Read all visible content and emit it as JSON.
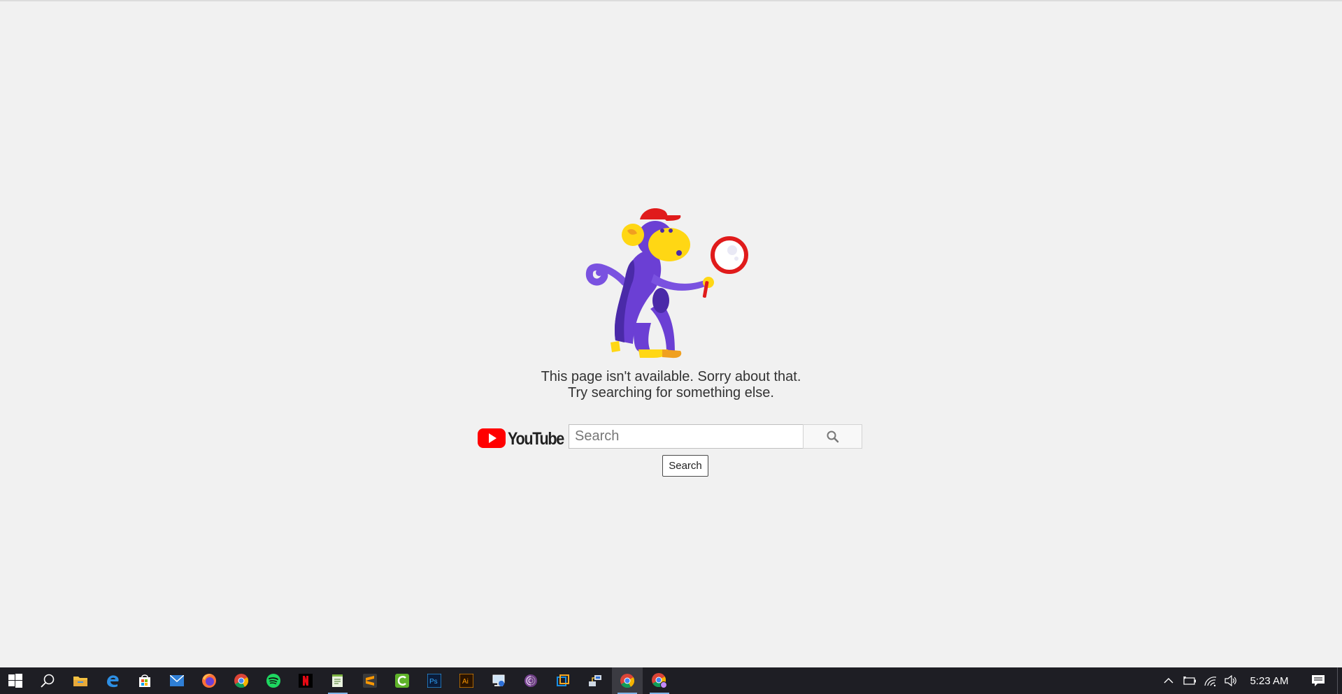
{
  "page": {
    "error_line1": "This page isn't available. Sorry about that.",
    "error_line2": "Try searching for something else."
  },
  "search": {
    "placeholder": "Search",
    "submit_label": "Search"
  },
  "logo": {
    "wordmark": "YouTube"
  },
  "taskbar": {
    "pinned_apps": [
      {
        "name": "start",
        "icon": "windows-icon"
      },
      {
        "name": "search",
        "icon": "search-icon"
      },
      {
        "name": "file-explorer",
        "icon": "folder-icon"
      },
      {
        "name": "edge",
        "icon": "edge-icon"
      },
      {
        "name": "store",
        "icon": "store-icon"
      },
      {
        "name": "mail",
        "icon": "mail-icon"
      },
      {
        "name": "firefox",
        "icon": "firefox-icon"
      },
      {
        "name": "chrome",
        "icon": "chrome-icon"
      },
      {
        "name": "spotify",
        "icon": "spotify-icon"
      },
      {
        "name": "netflix",
        "icon": "netflix-icon"
      },
      {
        "name": "notepad",
        "icon": "notepad-icon"
      },
      {
        "name": "sublime-text",
        "icon": "sublime-icon"
      },
      {
        "name": "camtasia",
        "icon": "camtasia-icon"
      },
      {
        "name": "photoshop",
        "icon": "photoshop-icon"
      },
      {
        "name": "illustrator",
        "icon": "illustrator-icon"
      },
      {
        "name": "remote-desktop",
        "icon": "remote-desktop-icon"
      },
      {
        "name": "tor-browser",
        "icon": "tor-icon"
      },
      {
        "name": "virtualbox",
        "icon": "virtualbox-icon"
      },
      {
        "name": "network-tool",
        "icon": "network-tool-icon"
      },
      {
        "name": "chrome-active",
        "icon": "chrome-icon"
      },
      {
        "name": "chrome-profile",
        "icon": "chrome-icon"
      }
    ],
    "clock": "5:23 AM",
    "tray_icons": [
      "chevron-up-icon",
      "battery-icon",
      "wifi-icon",
      "volume-icon",
      "notification-icon"
    ]
  },
  "colors": {
    "background": "#f1f1f1",
    "youtube_red": "#ff0000",
    "taskbar": "#1e1e24",
    "monkey_purple": "#6b3fd4",
    "monkey_yellow": "#ffd714"
  }
}
